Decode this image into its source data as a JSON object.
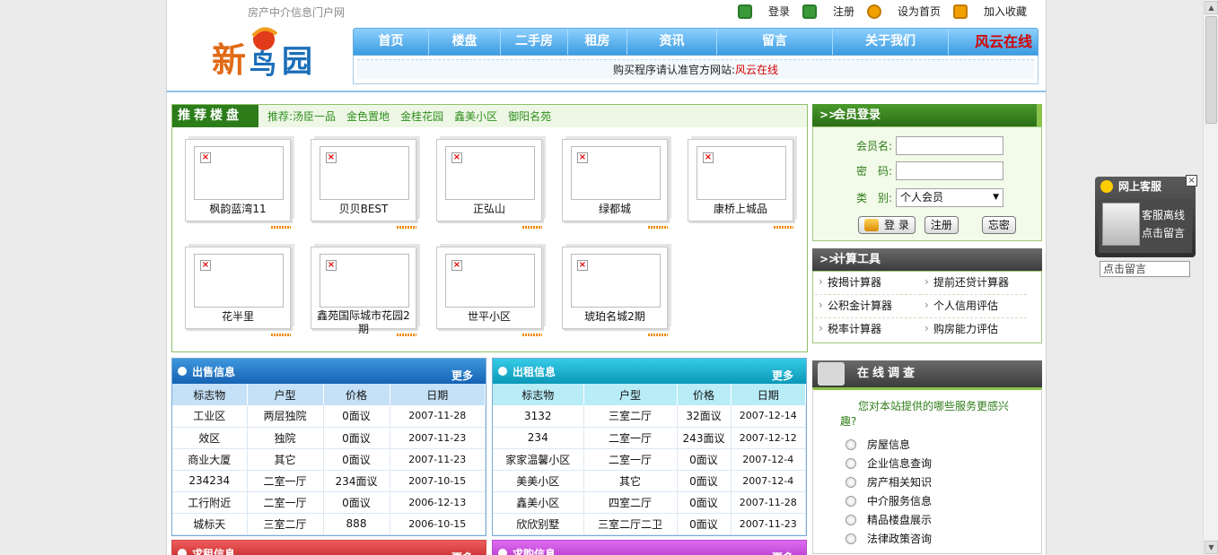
{
  "header": {
    "site_tag": "房产中介信息门户网",
    "logo_text": "新园",
    "top_links": [
      {
        "label": "登录",
        "icon": "home-icon",
        "color": "#3a9a3a"
      },
      {
        "label": "注册",
        "icon": "user-icon",
        "color": "#3a9a3a"
      },
      {
        "label": "设为首页",
        "icon": "globe-icon",
        "color": "#f0a000"
      },
      {
        "label": "加入收藏",
        "icon": "folder-icon",
        "color": "#f0a000"
      }
    ],
    "nav": [
      "首页",
      "楼盘",
      "二手房",
      "租房",
      "资讯",
      "留言",
      "关于我们"
    ],
    "nav_brand": "风云在线",
    "notice_prefix": "购买程序请认准官方网站:",
    "notice_site": "风云在线"
  },
  "recommend": {
    "title": "推荐楼盘",
    "links": [
      "推荐:汤臣一品",
      "金色置地",
      "金桂花园",
      "鑫美小区",
      "御阳名苑"
    ],
    "cards": [
      {
        "name": "枫韵蓝湾11"
      },
      {
        "name": "贝贝BEST"
      },
      {
        "name": "正弘山"
      },
      {
        "name": "绿都城"
      },
      {
        "name": "康桥上城品"
      },
      {
        "name": "花半里"
      },
      {
        "name": "鑫苑国际城市花园2期"
      },
      {
        "name": "世平小区"
      },
      {
        "name": "琥珀名城2期"
      }
    ]
  },
  "sale": {
    "title": "出售信息",
    "more": "更多",
    "columns": [
      "标志物",
      "户型",
      "价格",
      "日期"
    ],
    "rows": [
      [
        "工业区",
        "两层独院",
        "0面议",
        "2007-11-28"
      ],
      [
        "效区",
        "独院",
        "0面议",
        "2007-11-23"
      ],
      [
        "商业大厦",
        "其它",
        "0面议",
        "2007-11-23"
      ],
      [
        "234234",
        "二室一厅",
        "234面议",
        "2007-10-15"
      ],
      [
        "工行附近",
        "二室一厅",
        "0面议",
        "2006-12-13"
      ],
      [
        "城标天",
        "三室二厅",
        "888",
        "2006-10-15"
      ]
    ]
  },
  "rent": {
    "title": "出租信息",
    "more": "更多",
    "columns": [
      "标志物",
      "户型",
      "价格",
      "日期"
    ],
    "rows": [
      [
        "3132",
        "三室二厅",
        "32面议",
        "2007-12-14"
      ],
      [
        "234",
        "二室一厅",
        "243面议",
        "2007-12-12"
      ],
      [
        "家家温馨小区",
        "二室一厅",
        "0面议",
        "2007-12-4"
      ],
      [
        "美美小区",
        "其它",
        "0面议",
        "2007-12-4"
      ],
      [
        "鑫美小区",
        "四室二厅",
        "0面议",
        "2007-11-28"
      ],
      [
        "欣欣别墅",
        "三室二厅二卫",
        "0面议",
        "2007-11-23"
      ]
    ]
  },
  "want_rent": {
    "title": "求租信息",
    "more": "更多"
  },
  "want_buy": {
    "title": "求购信息",
    "more": "更多"
  },
  "login": {
    "title": "会员登录",
    "username_label": "会员名:",
    "password_label": "密　码:",
    "type_label": "类　别:",
    "type_value": "个人会员",
    "login_button": "登 录",
    "register_button": "注册",
    "forgot_button": "忘密"
  },
  "calc": {
    "title": "计算工具",
    "items": [
      "按揭计算器",
      "提前还贷计算器",
      "公积金计算器",
      "个人信用评估",
      "税率计算器",
      "购房能力评估"
    ]
  },
  "survey": {
    "title": "在线调查",
    "question": "您对本站提供的哪些服务更感兴趣?",
    "options": [
      "房屋信息",
      "企业信息查询",
      "房产相关知识",
      "中介服务信息",
      "精品楼盘展示",
      "法律政策咨询"
    ]
  },
  "service": {
    "title": "网上客服",
    "status_line1": "客服离线",
    "status_line2": "点击留言",
    "input_value": "点击留言"
  }
}
